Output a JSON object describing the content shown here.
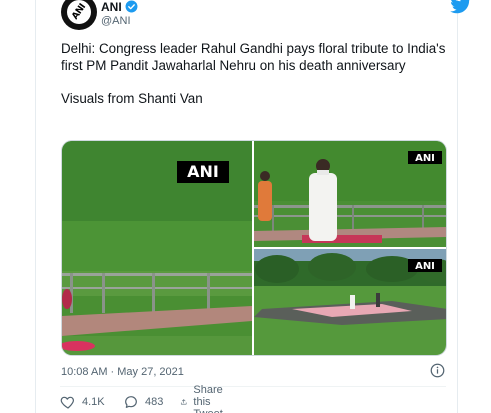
{
  "account": {
    "display_name": "ANI",
    "handle": "@ANI",
    "avatar_text": "ANI",
    "verified": true
  },
  "tweet": {
    "line1": "Delhi: Congress leader Rahul Gandhi pays floral tribute to India's first PM Pandit Jawaharlal Nehru on his death anniversary",
    "line2": "Visuals from Shanti Van"
  },
  "media": {
    "watermark": "ANI",
    "photo_count": 3
  },
  "meta": {
    "timestamp": "10:08 AM · May 27, 2021"
  },
  "actions": {
    "likes": "4.1K",
    "replies": "483",
    "share_label": "Share this Tweet"
  },
  "colors": {
    "brand_blue": "#1d9bf0",
    "muted_text": "#536471",
    "like_color": "#536471",
    "grass": "#3f8a2e"
  },
  "icons": [
    "verified-badge-icon",
    "twitter-bird-icon",
    "info-icon",
    "heart-icon",
    "reply-icon",
    "share-icon"
  ]
}
